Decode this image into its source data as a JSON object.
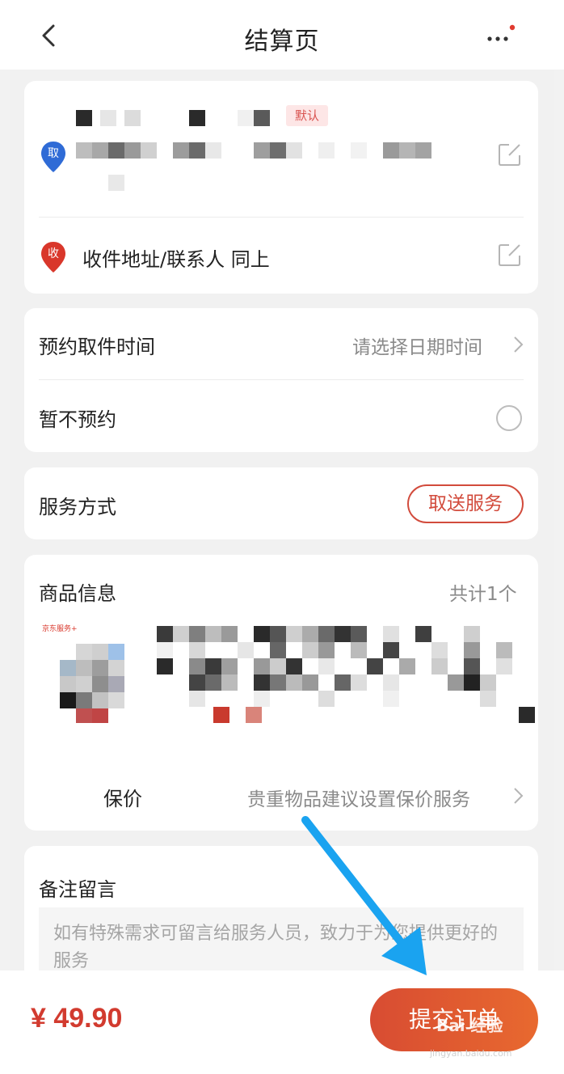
{
  "nav": {
    "title": "结算页"
  },
  "address": {
    "default_badge": "默认",
    "pickup_pin": "取",
    "receive_pin": "收",
    "receive_text": "收件地址/联系人 同上"
  },
  "pickup_time": {
    "label": "预约取件时间",
    "placeholder": "请选择日期时间",
    "no_appointment_label": "暂不预约"
  },
  "service": {
    "label": "服务方式",
    "value": "取送服务"
  },
  "goods": {
    "title": "商品信息",
    "count": "共计1个",
    "thumb_brand": "京东服务+",
    "insure_label": "保价",
    "insure_hint": "贵重物品建议设置保价服务"
  },
  "remark": {
    "title": "备注留言",
    "placeholder": "如有特殊需求可留言给服务人员，致力于为您提供更好的服务"
  },
  "footer": {
    "price": "¥ 49.90",
    "submit_label": "提交订单"
  },
  "watermark": {
    "brand": "Bai 经验",
    "domain": "jingyan.baidu.com"
  },
  "colors": {
    "accent": "#d23b2f",
    "pickup_pin": "#2f6bd6",
    "receive_pin": "#d9372b",
    "annotation_arrow": "#1aa3f0"
  },
  "icons": [
    "back-icon",
    "more-icon",
    "pickup-pin-icon",
    "receive-pin-icon",
    "edit-icon",
    "chevron-right-icon",
    "radio-icon",
    "annotation-arrow-icon"
  ]
}
